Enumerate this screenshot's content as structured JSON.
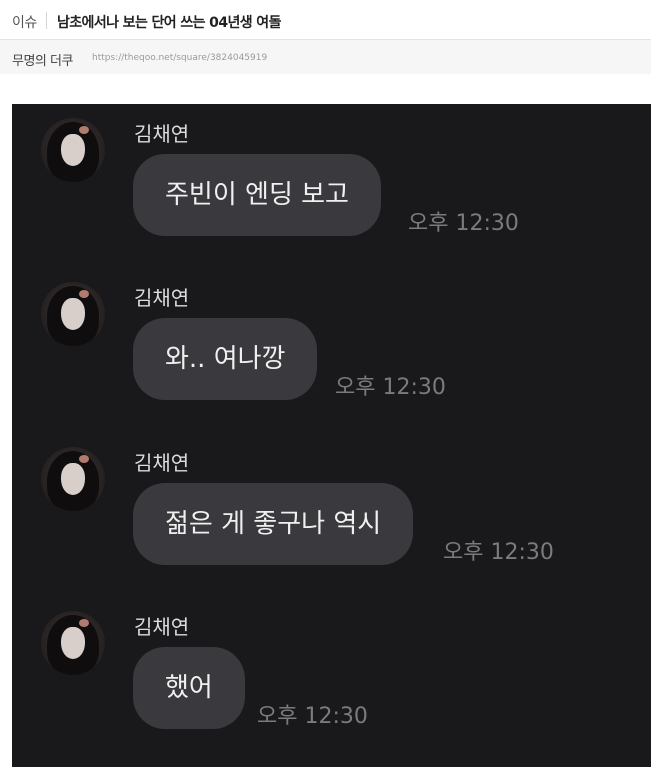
{
  "header": {
    "category": "이슈",
    "title": "남초에서나 보는 단어 쓰는 04년생 여돌"
  },
  "meta": {
    "author": "무명의 더쿠",
    "url": "https://theqoo.net/square/3824045919"
  },
  "chat": {
    "messages": [
      {
        "sender": "김채연",
        "text": "주빈이 엔딩 보고",
        "time": "오후 12:30"
      },
      {
        "sender": "김채연",
        "text": "와.. 여나깡",
        "time": "오후 12:30"
      },
      {
        "sender": "김채연",
        "text": "젊은 게 좋구나 역시",
        "time": "오후 12:30"
      },
      {
        "sender": "김채연",
        "text": "했어",
        "time": "오후 12:30"
      }
    ]
  },
  "colors": {
    "chat_background": "#19191b",
    "bubble": "#3a3a3e",
    "bubble_text": "#f0f0f0",
    "timestamp": "#7b7b7e"
  }
}
